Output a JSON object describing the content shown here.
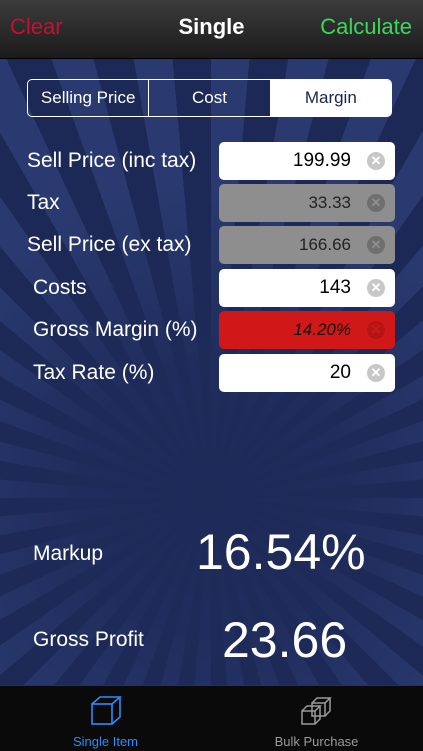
{
  "nav": {
    "left": "Clear",
    "title": "Single",
    "right": "Calculate"
  },
  "segments": [
    {
      "label": "Selling Price",
      "active": false
    },
    {
      "label": "Cost",
      "active": false
    },
    {
      "label": "Margin",
      "active": true
    }
  ],
  "rows": [
    {
      "label": "Sell Price (inc tax)",
      "value": "199.99"
    },
    {
      "label": "Tax",
      "value": "33.33"
    },
    {
      "label": "Sell Price (ex tax)",
      "value": "166.66"
    },
    {
      "label": "Costs",
      "value": "143"
    },
    {
      "label": "Gross Margin (%)",
      "value": "14.20%"
    },
    {
      "label": "Tax Rate (%)",
      "value": "20"
    }
  ],
  "results": {
    "markup_label": "Markup",
    "markup_value": "16.54%",
    "profit_label": "Gross Profit",
    "profit_value": "23.66"
  },
  "tabs": [
    {
      "label": "Single Item",
      "icon": "cube-icon"
    },
    {
      "label": "Bulk Purchase",
      "icon": "cubes-icon"
    }
  ],
  "colors": {
    "clear": "#c8102e",
    "calculate": "#3ad85a",
    "margin_field": "#d01818",
    "computed_field": "#8e8e8e",
    "active_tab": "#2a8cff",
    "background": "#1a2450"
  }
}
